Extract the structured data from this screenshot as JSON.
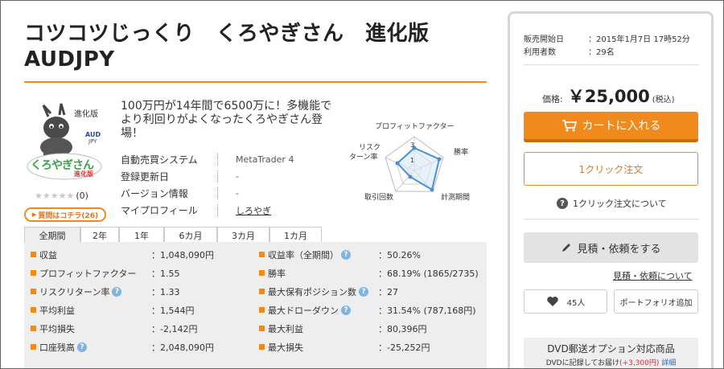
{
  "title": {
    "line1": "コツコツじっくり　くろやぎさん　進化版",
    "line2": "AUDJPY"
  },
  "product": {
    "image_badge": "進化版",
    "image_pair_top": "AUD",
    "image_pair_bottom": "JPY",
    "image_logo": "くろやぎさん",
    "image_logo_sub": "進化版",
    "stars": "★★★★★",
    "review_count": "(0)",
    "question_button": "質問はコチラ(26)",
    "description": "100万円が14年間で6500万に！多機能でより利回りがよくなったくろやぎさん登場！",
    "specs": [
      {
        "label": "自動売買システム",
        "value": "MetaTrader 4"
      },
      {
        "label": "登録更新日",
        "value": "-"
      },
      {
        "label": "バージョン情報",
        "value": "-"
      },
      {
        "label": "マイプロフィール",
        "value": "しろやぎ"
      }
    ]
  },
  "radar": {
    "labels": {
      "top": "プロフィットファクター",
      "right": "勝率",
      "bottom_right": "計測期間",
      "bottom_left": "取引回数",
      "left1": "リスク",
      "left2": "ターン率"
    },
    "scale_3": "3",
    "scale_1": "1",
    "colors": {
      "stroke": "#4a8fd4",
      "fill": "#d6e7f7"
    }
  },
  "tabs": [
    "全期間",
    "2年",
    "1年",
    "6カ月",
    "3カ月",
    "1カ月"
  ],
  "stats_left": [
    {
      "label": "収益",
      "value": "：1,048,090円",
      "help": false
    },
    {
      "label": "プロフィットファクター",
      "value": "：1.55",
      "help": false
    },
    {
      "label": "リスクリターン率",
      "value": "：1.33",
      "help": true
    },
    {
      "label": "平均利益",
      "value": "：1,544円",
      "help": false
    },
    {
      "label": "平均損失",
      "value": "：-2,142円",
      "help": false
    },
    {
      "label": "口座残高",
      "value": "：2,048,090円",
      "help": true
    }
  ],
  "stats_right": [
    {
      "label": "収益率（全期間）",
      "value": "：50.26%",
      "help": true
    },
    {
      "label": "勝率",
      "value": "：68.19% (1865/2735)",
      "help": false
    },
    {
      "label": "最大保有ポジション数",
      "value": "：27",
      "help": true
    },
    {
      "label": "最大ドローダウン",
      "value": "：31.54% (787,168円)",
      "help": true
    },
    {
      "label": "最大利益",
      "value": "：80,396円",
      "help": false
    },
    {
      "label": "最大損失",
      "value": "：-25,252円",
      "help": false
    }
  ],
  "help_glyph": "?",
  "sidebar": {
    "release_label": "販売開始日",
    "release_value": "：2015年1月7日 17時52分",
    "users_label": "利用者数",
    "users_value": "：29名",
    "price_label": "価格:",
    "price_amount": "￥25,000",
    "price_tax": "(税込)",
    "cart_button": "カートに入れる",
    "oneclick_button": "1クリック注文",
    "oneclick_help": "1クリック注文について",
    "estimate_button": "見積・依頼をする",
    "estimate_link": "見積・依頼について",
    "like_count": "45人",
    "portfolio_button": "ポートフォリオ追加",
    "dvd_title": "DVD郵送オプション対応商品",
    "dvd_sub_a": "DVDに記録してお届け",
    "dvd_sub_price": "(+3,300円)",
    "dvd_sub_link": "詳細"
  },
  "colors": {
    "accent": "#f08a1c",
    "help": "#7fb4e0"
  }
}
